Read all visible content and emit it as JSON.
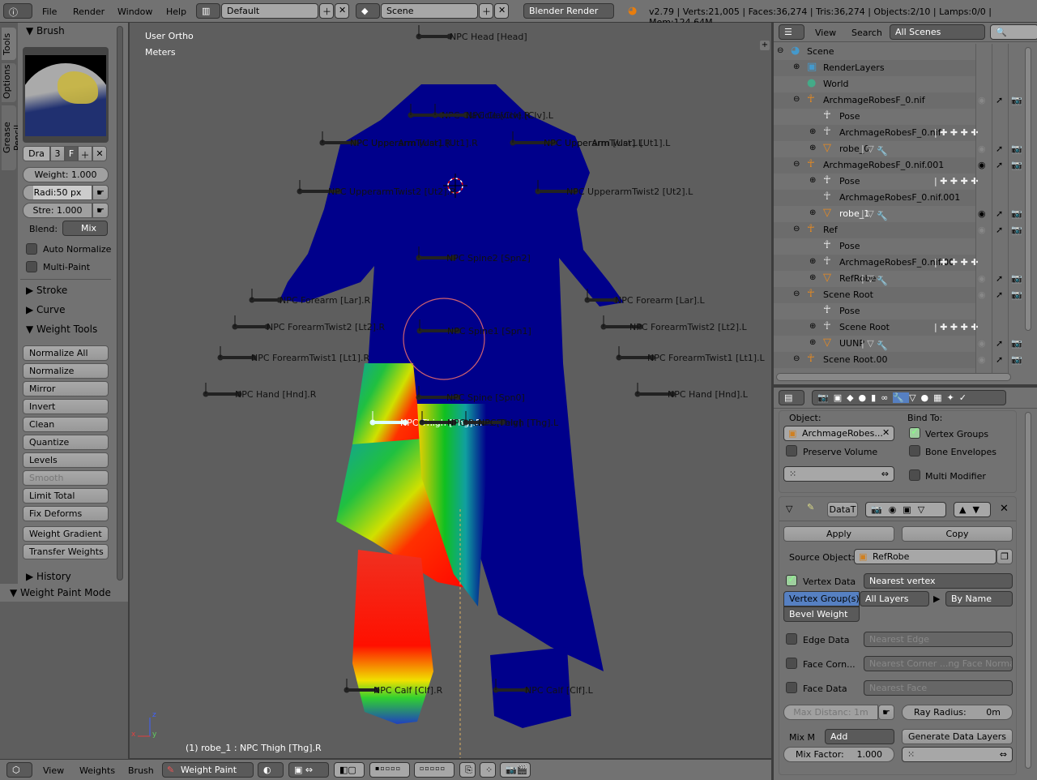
{
  "topbar": {
    "menus": [
      "File",
      "Render",
      "Window",
      "Help"
    ],
    "layout": "Default",
    "scene": "Scene",
    "engine": "Blender Render",
    "stats": "v2.79 | Verts:21,005 | Faces:36,274 | Tris:36,274 | Objects:2/10 | Lamps:0/0 | Mem:124.64M"
  },
  "tabs": [
    "Tools",
    "Options",
    "Grease Pencil"
  ],
  "tools": {
    "brush_header": "Brush",
    "brush_name": "Dra",
    "brush_users": "3",
    "brush_fake": "F",
    "weight": "Weight:  1.000",
    "radius": "Radi:50 px",
    "strength": "Stre: 1.000",
    "blend_label": "Blend:",
    "blend_value": "Mix",
    "auto_normalize": "Auto Normalize",
    "multi_paint": "Multi-Paint",
    "stroke": "Stroke",
    "curve": "Curve",
    "weight_tools": "Weight Tools",
    "buttons": [
      "Normalize All",
      "Normalize",
      "Mirror",
      "Invert",
      "Clean",
      "Quantize",
      "Levels",
      "Smooth",
      "Limit Total",
      "Fix Deforms",
      "Weight Gradient",
      "Transfer Weights"
    ],
    "disabled_button": "Smooth",
    "history": "History",
    "mode_panel": "Weight Paint Mode"
  },
  "viewport": {
    "view_name": "User Ortho",
    "units": "Meters",
    "status": "(1) robe_1 : NPC Thigh [Thg].R",
    "colors": {
      "robe": "#00008b",
      "background": "#5e5e5e",
      "brush_circle": "#d06070"
    },
    "bones": [
      {
        "label": "NPC Head [Head]"
      },
      {
        "label": "NPC Clavicle [Clv].R"
      },
      {
        "label": "NPC Clavicle [Clv].L"
      },
      {
        "label": "NPC UpperArm [Uar].R"
      },
      {
        "label": "NPC UpperarmTwist1 [Ut1].R"
      },
      {
        "label": "NPC UpperArm [Uar].L"
      },
      {
        "label": "NPC UpperarmTwist1 [Ut1].L"
      },
      {
        "label": "NPC UpperarmTwist2 [Ut2].R"
      },
      {
        "label": "NPC UpperarmTwist2 [Ut2].L"
      },
      {
        "label": "NPC Spine2 [Spn2]"
      },
      {
        "label": "NPC Forearm [Lar].R"
      },
      {
        "label": "NPC Forearm [Lar].L"
      },
      {
        "label": "NPC ForearmTwist2 [Lt2].R"
      },
      {
        "label": "NPC ForearmTwist2 [Lt2].L"
      },
      {
        "label": "NPC Spine1 [Spn1]"
      },
      {
        "label": "NPC ForearmTwist1 [Lt1].R"
      },
      {
        "label": "NPC ForearmTwist1 [Lt1].L"
      },
      {
        "label": "NPC Hand [Hnd].R"
      },
      {
        "label": "NPC Hand [Hnd].L"
      },
      {
        "label": "NPC Spine [Spn0]"
      },
      {
        "label": "NPC Thigh [Thg].R",
        "active": true
      },
      {
        "label": "NPC Pelvis [Pelv]"
      },
      {
        "label": "NPC Thigh [Thg].L"
      },
      {
        "label": "NPC Calf [Clf].R"
      },
      {
        "label": "NPC Calf [Clf].L"
      }
    ]
  },
  "outliner": {
    "menus": [
      "View",
      "Search"
    ],
    "filter": "All Scenes",
    "rows": [
      {
        "label": "Scene",
        "icon": "scene-icon",
        "depth": 0,
        "exp": "-"
      },
      {
        "label": "RenderLayers",
        "icon": "renderlayers-icon",
        "depth": 1,
        "exp": "+"
      },
      {
        "label": "World",
        "icon": "world-icon",
        "depth": 1,
        "exp": ""
      },
      {
        "label": "ArchmageRobesF_0.nif",
        "icon": "armature-icon",
        "depth": 1,
        "exp": "-",
        "vis": "hidden"
      },
      {
        "label": "Pose",
        "icon": "pose-icon",
        "depth": 2,
        "exp": ""
      },
      {
        "label": "ArchmageRobesF_0.nif",
        "icon": "armature-data-icon",
        "depth": 2,
        "exp": "+",
        "extra": "bones"
      },
      {
        "label": "robe_0",
        "icon": "mesh-icon",
        "depth": 2,
        "exp": "+",
        "extra": "mesh",
        "vis": "hidden"
      },
      {
        "label": "ArchmageRobesF_0.nif.001",
        "icon": "armature-icon",
        "depth": 1,
        "exp": "-",
        "vis": "visible"
      },
      {
        "label": "Pose",
        "icon": "pose-icon",
        "depth": 2,
        "exp": "+",
        "extra": "bones"
      },
      {
        "label": "ArchmageRobesF_0.nif.001",
        "icon": "armature-data-icon",
        "depth": 2,
        "exp": ""
      },
      {
        "label": "robe_1",
        "icon": "mesh-icon",
        "depth": 2,
        "exp": "+",
        "extra": "mesh",
        "vis": "visible",
        "active": true
      },
      {
        "label": "Ref",
        "icon": "armature-icon",
        "depth": 1,
        "exp": "-",
        "vis": "hidden"
      },
      {
        "label": "Pose",
        "icon": "pose-icon",
        "depth": 2,
        "exp": ""
      },
      {
        "label": "ArchmageRobesF_0.nif.00",
        "icon": "armature-data-icon",
        "depth": 2,
        "exp": "+",
        "extra": "bones"
      },
      {
        "label": "RefRobe",
        "icon": "mesh-icon",
        "depth": 2,
        "exp": "+",
        "extra": "mesh",
        "vis": "hidden"
      },
      {
        "label": "Scene Root",
        "icon": "armature-icon",
        "depth": 1,
        "exp": "-",
        "vis": "hidden"
      },
      {
        "label": "Pose",
        "icon": "pose-icon",
        "depth": 2,
        "exp": ""
      },
      {
        "label": "Scene Root",
        "icon": "armature-data-icon",
        "depth": 2,
        "exp": "+",
        "extra": "bones"
      },
      {
        "label": "UUNP",
        "icon": "mesh-icon",
        "depth": 2,
        "exp": "+",
        "extra": "mesh",
        "vis": "hidden"
      },
      {
        "label": "Scene Root.00",
        "icon": "armature-icon",
        "depth": 1,
        "exp": "-",
        "vis": "hidden"
      }
    ]
  },
  "properties": {
    "armature": {
      "object_label": "Object:",
      "object_value": "ArchmageRobes...",
      "bind_to": "Bind To:",
      "preserve_volume": "Preserve Volume",
      "vertex_groups": "Vertex Groups",
      "bone_envelopes": "Bone Envelopes",
      "multi_modifier": "Multi Modifier"
    },
    "transfer": {
      "name": "DataT",
      "apply": "Apply",
      "copy": "Copy",
      "source_label": "Source Object:",
      "source_value": "RefRobe",
      "vertex_data": "Vertex Data",
      "vertex_mapping": "Nearest vertex",
      "vg_types": [
        "Vertex Group(s)",
        "Bevel Weight"
      ],
      "layers_src": "All Layers",
      "layers_dst": "By Name",
      "edge_data": "Edge Data",
      "edge_mapping": "Nearest Edge",
      "face_corner": "Face Corn...",
      "face_corner_mapping": "Nearest Corner ...ng Face Norma",
      "face_data": "Face Data",
      "face_mapping": "Nearest Face",
      "max_distance": "Max Distanc: 1m",
      "ray_radius_label": "Ray Radius:",
      "ray_radius_value": "0m",
      "mix_mode_label": "Mix M",
      "mix_mode": "Add",
      "generate": "Generate Data Layers",
      "mix_factor_label": "Mix Factor:",
      "mix_factor_value": "1.000"
    }
  },
  "bottombar": {
    "menus": [
      "View",
      "Weights",
      "Brush"
    ],
    "mode": "Weight Paint"
  }
}
